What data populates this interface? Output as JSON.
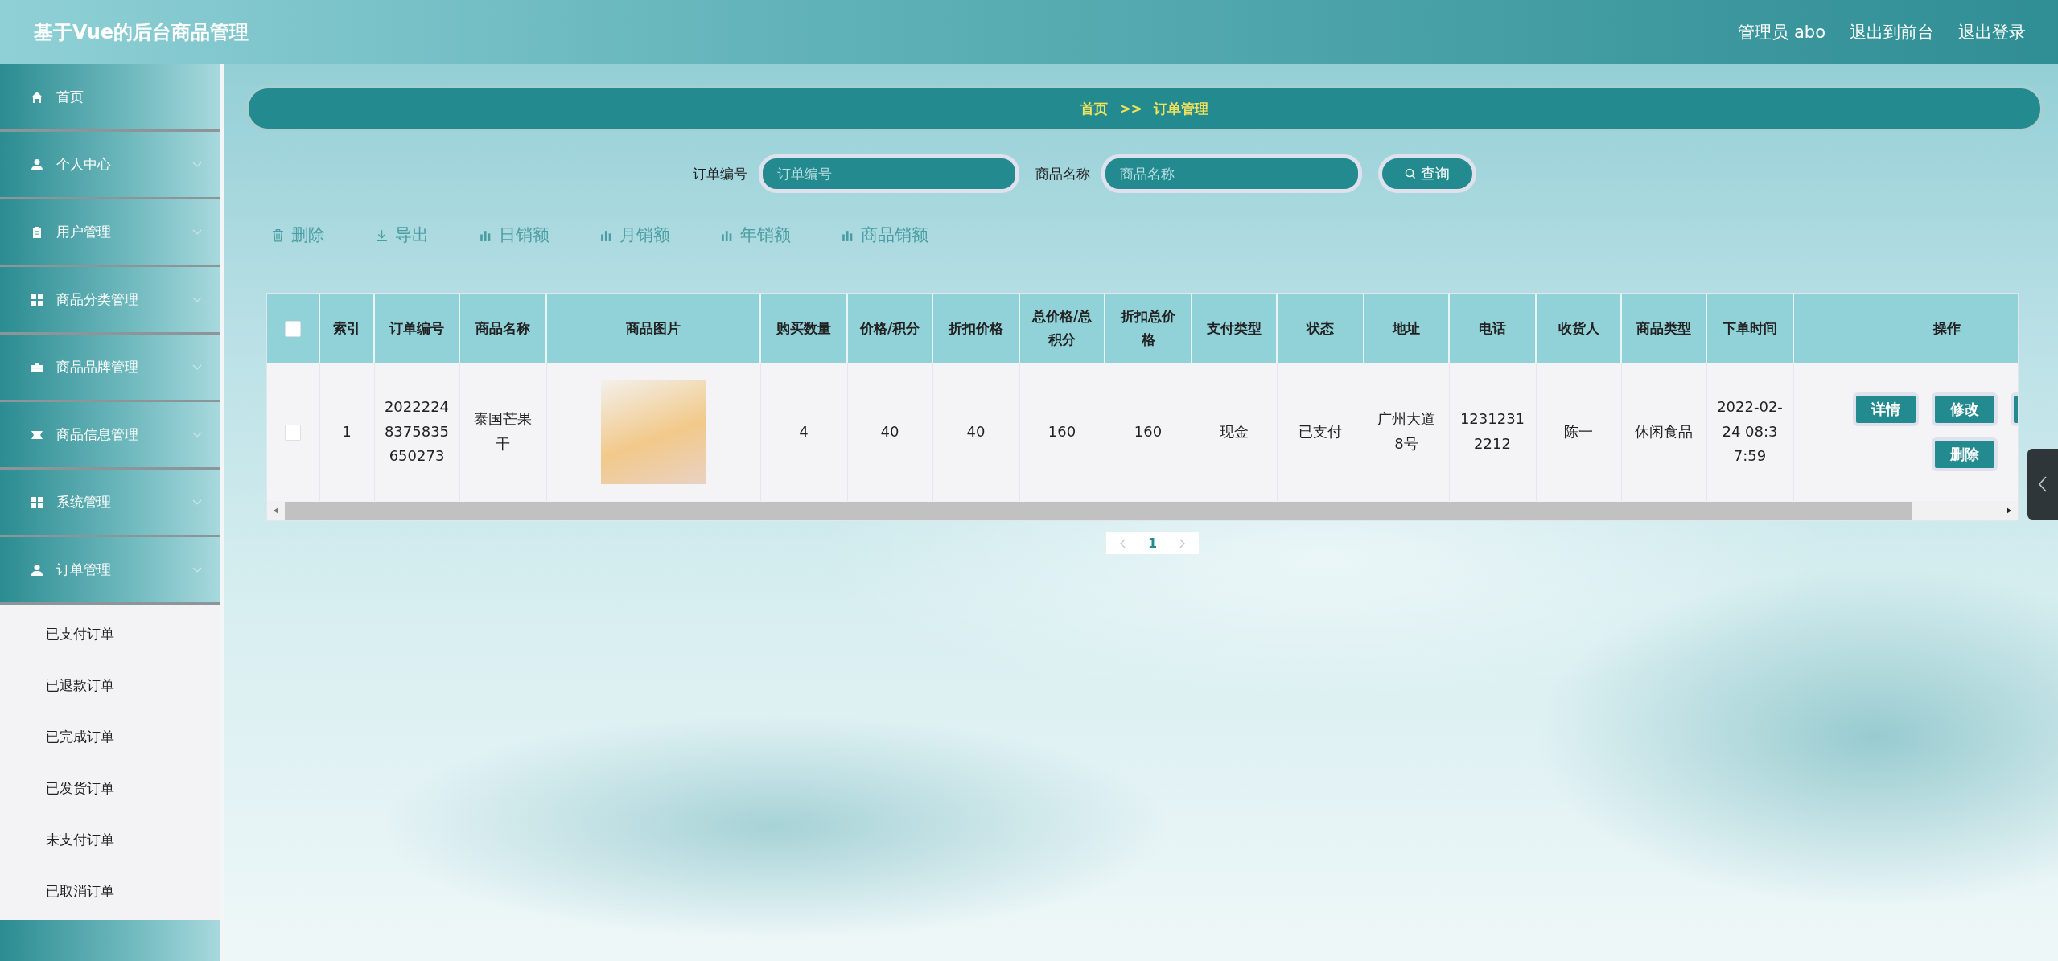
{
  "header": {
    "title": "基于Vue的后台商品管理",
    "user": "管理员 abo",
    "links": [
      "退出到前台",
      "退出登录"
    ]
  },
  "sidebar": {
    "items": [
      {
        "label": "首页",
        "kind": "link"
      },
      {
        "label": "个人中心",
        "kind": "menu"
      },
      {
        "label": "用户管理",
        "kind": "menu"
      },
      {
        "label": "商品分类管理",
        "kind": "menu"
      },
      {
        "label": "商品品牌管理",
        "kind": "menu"
      },
      {
        "label": "商品信息管理",
        "kind": "menu"
      },
      {
        "label": "系统管理",
        "kind": "menu"
      },
      {
        "label": "订单管理",
        "kind": "menu",
        "children": [
          "已支付订单",
          "已退款订单",
          "已完成订单",
          "已发货订单",
          "未支付订单",
          "已取消订单"
        ]
      }
    ]
  },
  "breadcrumb": [
    "首页",
    ">>",
    "订单管理"
  ],
  "search": {
    "fields": [
      {
        "label": "订单编号",
        "placeholder": "订单编号"
      },
      {
        "label": "商品名称",
        "placeholder": "商品名称"
      }
    ],
    "button": "查询"
  },
  "toolbar": [
    "删除",
    "导出",
    "日销额",
    "月销额",
    "年销额",
    "商品销额"
  ],
  "table": {
    "select_all": {
      "checked": false
    },
    "columns": [
      "索引",
      "订单编号",
      "商品名称",
      "商品图片",
      "购买数量",
      "价格/积分",
      "折扣价格",
      "总价格/总积分",
      "折扣总价格",
      "支付类型",
      "状态",
      "地址",
      "电话",
      "收货人",
      "商品类型",
      "下单时间",
      "操作"
    ],
    "rows": [
      {
        "checked": false,
        "cells": [
          "1",
          "20222248375835650273",
          "泰国芒果干",
          "",
          "4",
          "40",
          "40",
          "160",
          "160",
          "现金",
          "已支付",
          "广州大道8号",
          "12312312212",
          "陈一",
          "休闲食品",
          "2022-02-24 08:37:59"
        ],
        "actions": [
          "详情",
          "修改",
          "删除"
        ]
      }
    ]
  },
  "pagination": {
    "pages": [
      {
        "label": "1",
        "selected": true
      }
    ]
  }
}
